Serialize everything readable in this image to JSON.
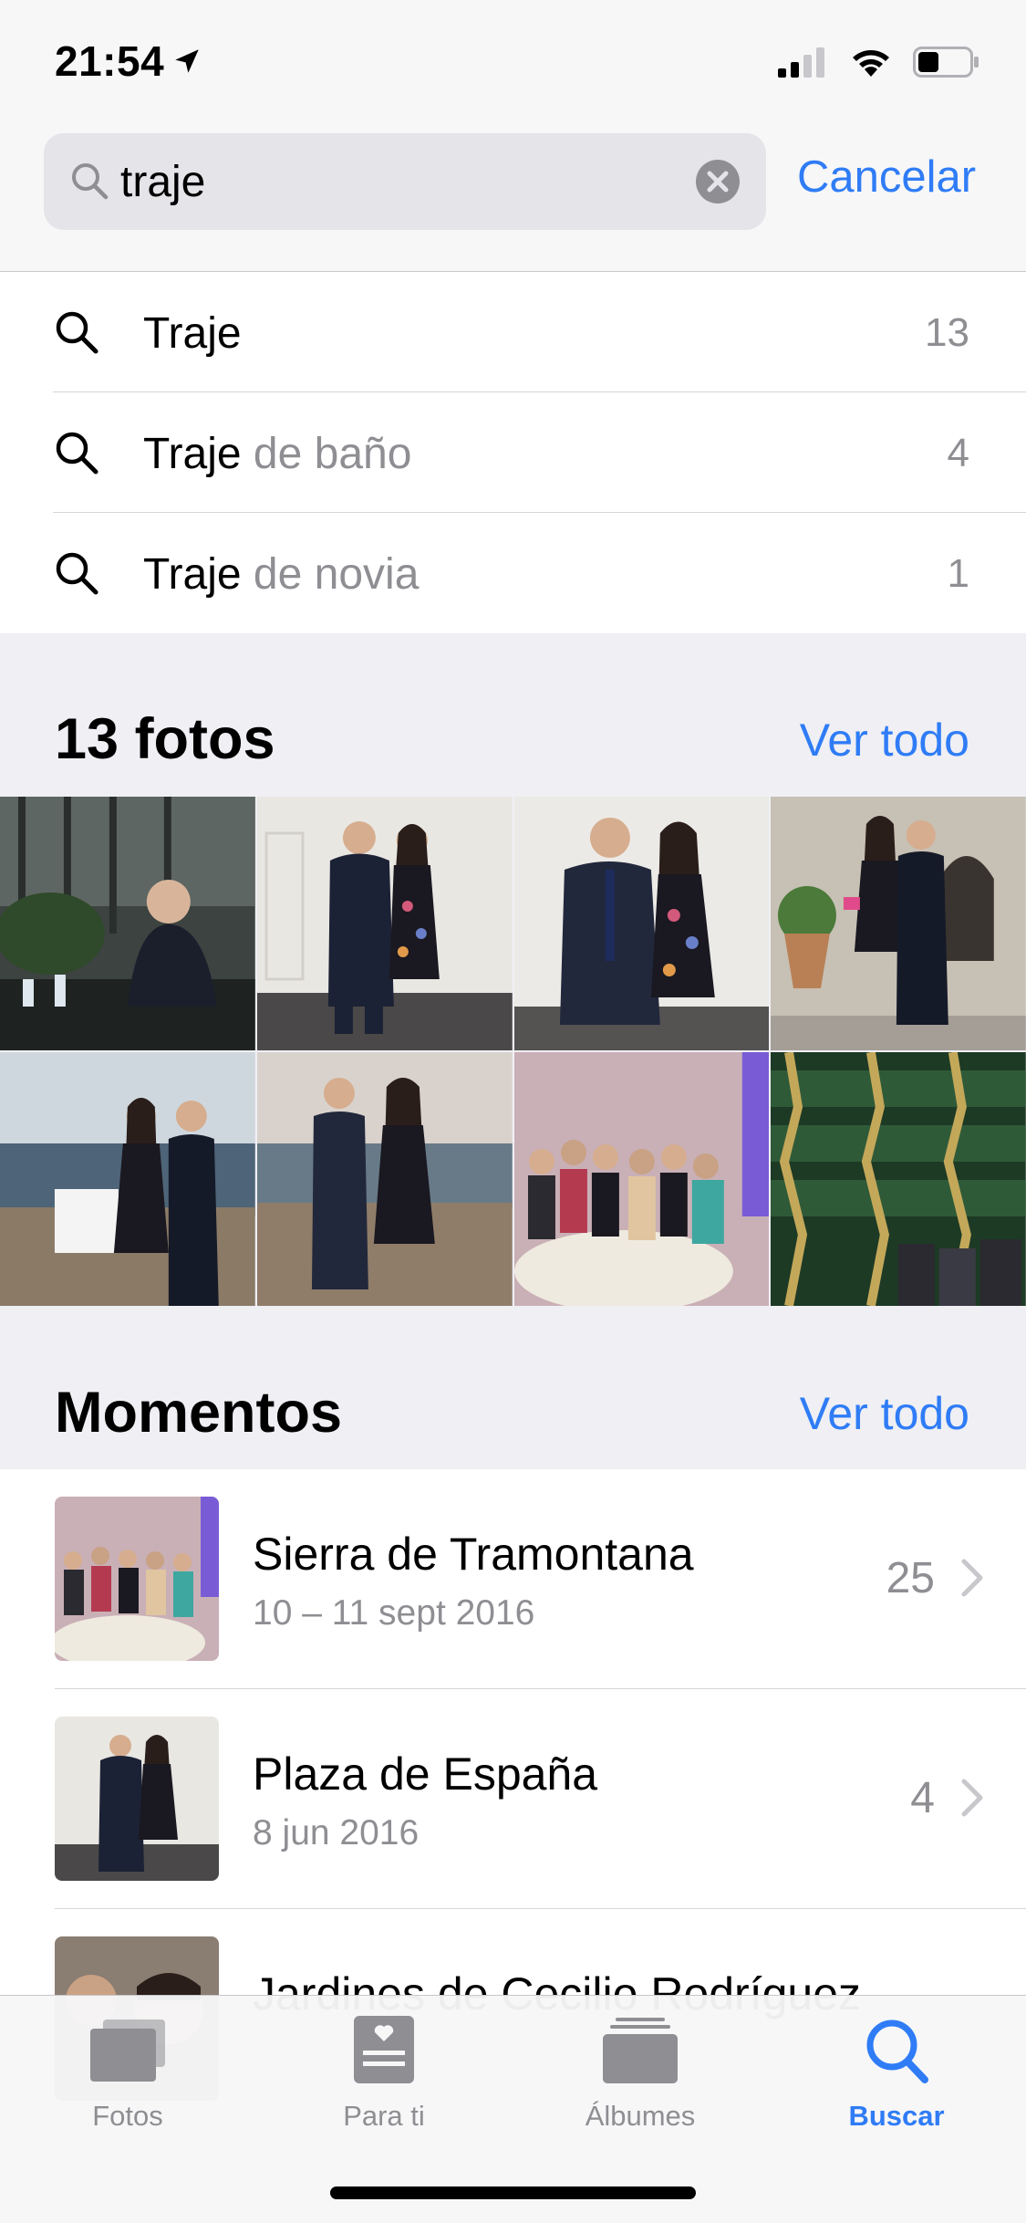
{
  "status_bar": {
    "time": "21:54"
  },
  "search": {
    "value": "traje",
    "cancel_label": "Cancelar"
  },
  "suggestions": [
    {
      "bold": "Traje",
      "rest": "",
      "count": "13"
    },
    {
      "bold": "Traje",
      "rest": " de baño",
      "count": "4"
    },
    {
      "bold": "Traje",
      "rest": " de novia",
      "count": "1"
    }
  ],
  "photos_section": {
    "title": "13 fotos",
    "see_all": "Ver todo"
  },
  "moments_section": {
    "title": "Momentos",
    "see_all": "Ver todo",
    "items": [
      {
        "title": "Sierra de Tramontana",
        "date": "10 – 11 sept 2016",
        "count": "25"
      },
      {
        "title": "Plaza de España",
        "date": "8 jun 2016",
        "count": "4"
      },
      {
        "title": "Jardines de Cecilio Rodríguez",
        "date": "",
        "count": ""
      }
    ]
  },
  "tabbar": {
    "tabs": [
      {
        "label": "Fotos",
        "icon": "photos-stack-icon"
      },
      {
        "label": "Para ti",
        "icon": "for-you-icon"
      },
      {
        "label": "Álbumes",
        "icon": "albums-icon"
      },
      {
        "label": "Buscar",
        "icon": "search-icon",
        "active": true
      }
    ]
  },
  "colors": {
    "accent": "#2f7cf6",
    "secondary_text": "#8e8e93",
    "grouped_background": "#efeff4"
  }
}
